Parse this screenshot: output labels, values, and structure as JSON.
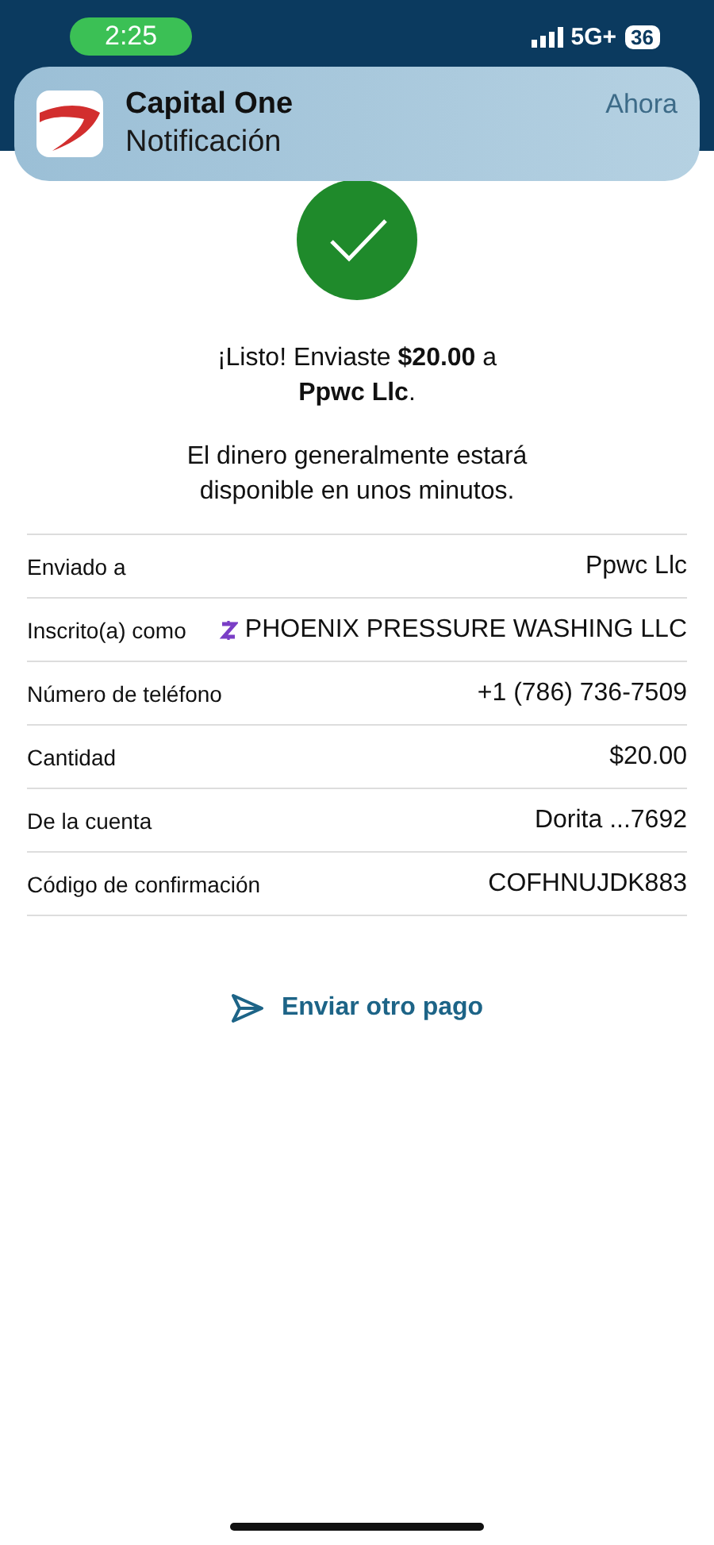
{
  "status_bar": {
    "time": "2:25",
    "network": "5G+",
    "battery": "36"
  },
  "notification": {
    "app": "Capital One",
    "text": "Notificación",
    "time": "Ahora"
  },
  "confirmation": {
    "message": "¡Listo! Enviaste **$20.00** a **Ppwc Llc**.",
    "note": "El dinero generalmente estará disponible en unos minutos."
  },
  "details": [
    {
      "label": "Enviado a",
      "value": "Ppwc Llc",
      "kind": "plain"
    },
    {
      "label": "Inscrito(a) como",
      "value": "PHOENIX PRESSURE WASHING LLC",
      "kind": "zelle"
    },
    {
      "label": "Número de teléfono",
      "value": "+1 (786) 736-7509",
      "kind": "plain"
    },
    {
      "label": "Cantidad",
      "value": "$20.00",
      "kind": "plain"
    },
    {
      "label": "De la cuenta",
      "value": "Dorita ...7692",
      "kind": "plain"
    },
    {
      "label": "Código de confirmación",
      "value": "COFHNUJDK883",
      "kind": "plain"
    }
  ],
  "action": {
    "label": "Enviar otro pago"
  }
}
